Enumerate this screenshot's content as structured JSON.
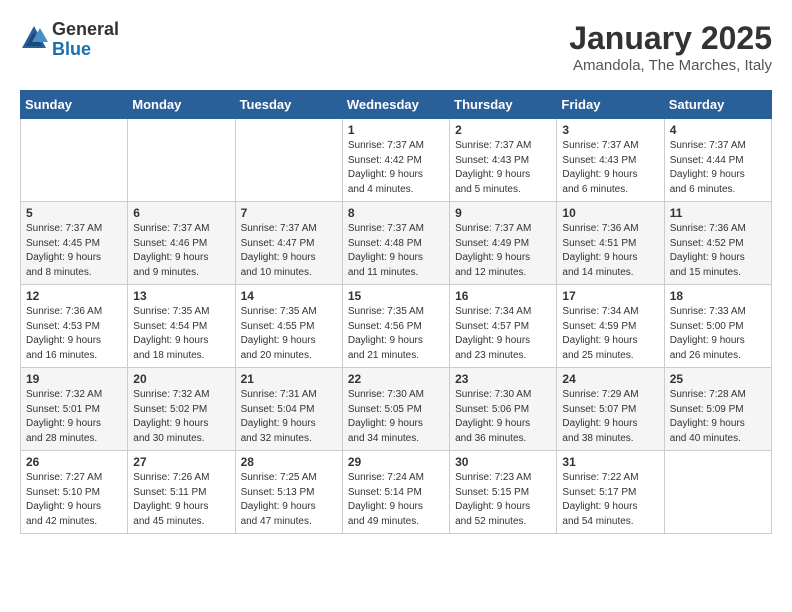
{
  "logo": {
    "general": "General",
    "blue": "Blue"
  },
  "header": {
    "month": "January 2025",
    "location": "Amandola, The Marches, Italy"
  },
  "weekdays": [
    "Sunday",
    "Monday",
    "Tuesday",
    "Wednesday",
    "Thursday",
    "Friday",
    "Saturday"
  ],
  "weeks": [
    [
      {
        "day": "",
        "info": ""
      },
      {
        "day": "",
        "info": ""
      },
      {
        "day": "",
        "info": ""
      },
      {
        "day": "1",
        "info": "Sunrise: 7:37 AM\nSunset: 4:42 PM\nDaylight: 9 hours\nand 4 minutes."
      },
      {
        "day": "2",
        "info": "Sunrise: 7:37 AM\nSunset: 4:43 PM\nDaylight: 9 hours\nand 5 minutes."
      },
      {
        "day": "3",
        "info": "Sunrise: 7:37 AM\nSunset: 4:43 PM\nDaylight: 9 hours\nand 6 minutes."
      },
      {
        "day": "4",
        "info": "Sunrise: 7:37 AM\nSunset: 4:44 PM\nDaylight: 9 hours\nand 6 minutes."
      }
    ],
    [
      {
        "day": "5",
        "info": "Sunrise: 7:37 AM\nSunset: 4:45 PM\nDaylight: 9 hours\nand 8 minutes."
      },
      {
        "day": "6",
        "info": "Sunrise: 7:37 AM\nSunset: 4:46 PM\nDaylight: 9 hours\nand 9 minutes."
      },
      {
        "day": "7",
        "info": "Sunrise: 7:37 AM\nSunset: 4:47 PM\nDaylight: 9 hours\nand 10 minutes."
      },
      {
        "day": "8",
        "info": "Sunrise: 7:37 AM\nSunset: 4:48 PM\nDaylight: 9 hours\nand 11 minutes."
      },
      {
        "day": "9",
        "info": "Sunrise: 7:37 AM\nSunset: 4:49 PM\nDaylight: 9 hours\nand 12 minutes."
      },
      {
        "day": "10",
        "info": "Sunrise: 7:36 AM\nSunset: 4:51 PM\nDaylight: 9 hours\nand 14 minutes."
      },
      {
        "day": "11",
        "info": "Sunrise: 7:36 AM\nSunset: 4:52 PM\nDaylight: 9 hours\nand 15 minutes."
      }
    ],
    [
      {
        "day": "12",
        "info": "Sunrise: 7:36 AM\nSunset: 4:53 PM\nDaylight: 9 hours\nand 16 minutes."
      },
      {
        "day": "13",
        "info": "Sunrise: 7:35 AM\nSunset: 4:54 PM\nDaylight: 9 hours\nand 18 minutes."
      },
      {
        "day": "14",
        "info": "Sunrise: 7:35 AM\nSunset: 4:55 PM\nDaylight: 9 hours\nand 20 minutes."
      },
      {
        "day": "15",
        "info": "Sunrise: 7:35 AM\nSunset: 4:56 PM\nDaylight: 9 hours\nand 21 minutes."
      },
      {
        "day": "16",
        "info": "Sunrise: 7:34 AM\nSunset: 4:57 PM\nDaylight: 9 hours\nand 23 minutes."
      },
      {
        "day": "17",
        "info": "Sunrise: 7:34 AM\nSunset: 4:59 PM\nDaylight: 9 hours\nand 25 minutes."
      },
      {
        "day": "18",
        "info": "Sunrise: 7:33 AM\nSunset: 5:00 PM\nDaylight: 9 hours\nand 26 minutes."
      }
    ],
    [
      {
        "day": "19",
        "info": "Sunrise: 7:32 AM\nSunset: 5:01 PM\nDaylight: 9 hours\nand 28 minutes."
      },
      {
        "day": "20",
        "info": "Sunrise: 7:32 AM\nSunset: 5:02 PM\nDaylight: 9 hours\nand 30 minutes."
      },
      {
        "day": "21",
        "info": "Sunrise: 7:31 AM\nSunset: 5:04 PM\nDaylight: 9 hours\nand 32 minutes."
      },
      {
        "day": "22",
        "info": "Sunrise: 7:30 AM\nSunset: 5:05 PM\nDaylight: 9 hours\nand 34 minutes."
      },
      {
        "day": "23",
        "info": "Sunrise: 7:30 AM\nSunset: 5:06 PM\nDaylight: 9 hours\nand 36 minutes."
      },
      {
        "day": "24",
        "info": "Sunrise: 7:29 AM\nSunset: 5:07 PM\nDaylight: 9 hours\nand 38 minutes."
      },
      {
        "day": "25",
        "info": "Sunrise: 7:28 AM\nSunset: 5:09 PM\nDaylight: 9 hours\nand 40 minutes."
      }
    ],
    [
      {
        "day": "26",
        "info": "Sunrise: 7:27 AM\nSunset: 5:10 PM\nDaylight: 9 hours\nand 42 minutes."
      },
      {
        "day": "27",
        "info": "Sunrise: 7:26 AM\nSunset: 5:11 PM\nDaylight: 9 hours\nand 45 minutes."
      },
      {
        "day": "28",
        "info": "Sunrise: 7:25 AM\nSunset: 5:13 PM\nDaylight: 9 hours\nand 47 minutes."
      },
      {
        "day": "29",
        "info": "Sunrise: 7:24 AM\nSunset: 5:14 PM\nDaylight: 9 hours\nand 49 minutes."
      },
      {
        "day": "30",
        "info": "Sunrise: 7:23 AM\nSunset: 5:15 PM\nDaylight: 9 hours\nand 52 minutes."
      },
      {
        "day": "31",
        "info": "Sunrise: 7:22 AM\nSunset: 5:17 PM\nDaylight: 9 hours\nand 54 minutes."
      },
      {
        "day": "",
        "info": ""
      }
    ]
  ]
}
